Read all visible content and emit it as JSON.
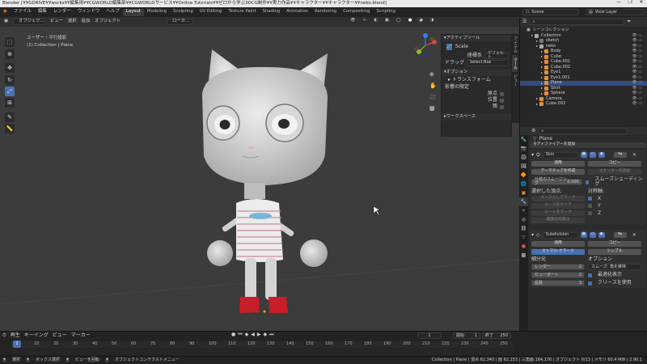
{
  "title_bar": {
    "text": "Blender [¥¥GDRIVE¥¥works¥¥編集用¥¥CGWORLD編集部¥¥CGWORLDサービス¥¥Online Tutorials¥¥ゼロから学ぶ3DCG制作¥¥実力作品¥¥キャラクター¥¥キャラクター¥¥neko.blend]",
    "controls": [
      "—",
      "❐",
      "✕"
    ]
  },
  "top_bar": {
    "menus": [
      "ファイル",
      "編集",
      "レンダー",
      "ウィンドウ",
      "ヘルプ"
    ],
    "workspaces": [
      "Layout",
      "Modeling",
      "Sculpting",
      "UV Editing",
      "Texture Paint",
      "Shading",
      "Animation",
      "Rendering",
      "Compositing",
      "Scripting"
    ],
    "active_workspace": "Layout",
    "scene_label": "Scene",
    "view_layer_label": "View Layer"
  },
  "viewport_header": {
    "mode": "オブジェク...",
    "items": [
      "ビュー",
      "選択",
      "追加",
      "オブジェクト"
    ],
    "orientation": "デフォルト",
    "drag": "ドラッ...",
    "select_mode": "Select Box",
    "pivot": "ローカ..."
  },
  "viewport": {
    "view_name": "ユーザー・平行投影",
    "collection_info": "(1) Collection | Plane"
  },
  "sidebar_tabs": [
    "アイテム",
    "ツール",
    "ビュー"
  ],
  "tool_panel": {
    "active_tool_header": "アクティブツール",
    "tool_name": "Scale",
    "orientation_label": "座標系",
    "orientation_value": "デフォルト",
    "drag_label": "ドラッグ",
    "drag_value": "Select Box",
    "options_header": "オプション",
    "transform_header": "トランスフォーム",
    "affect_only_label": "影響の限定",
    "affect_items": [
      "原点",
      "位置",
      "親"
    ],
    "workspace_header": "ワークスペース"
  },
  "outliner": {
    "header": "シーンコレクション",
    "items": [
      {
        "name": "Collection",
        "indent": 1,
        "color": "#aaaaaa"
      },
      {
        "name": "sketch",
        "indent": 2,
        "color": "#777777"
      },
      {
        "name": "neko",
        "indent": 2,
        "color": "#aaaaaa"
      },
      {
        "name": "Body",
        "indent": 3,
        "color": "#e0903a"
      },
      {
        "name": "Cube",
        "indent": 3,
        "color": "#e0903a"
      },
      {
        "name": "Cube.001",
        "indent": 3,
        "color": "#e0903a"
      },
      {
        "name": "Cube.002",
        "indent": 3,
        "color": "#e0903a"
      },
      {
        "name": "Eye1",
        "indent": 3,
        "color": "#e0903a"
      },
      {
        "name": "Eye1.001",
        "indent": 3,
        "color": "#e0903a"
      },
      {
        "name": "Plane",
        "indent": 3,
        "color": "#e0903a"
      },
      {
        "name": "Shirt",
        "indent": 3,
        "color": "#e0903a"
      },
      {
        "name": "Sphere",
        "indent": 3,
        "color": "#e0903a"
      },
      {
        "name": "Camera",
        "indent": 2,
        "color": "#e0903a"
      },
      {
        "name": "Cube.003",
        "indent": 2,
        "color": "#e0903a"
      }
    ]
  },
  "properties": {
    "object_name": "Plane",
    "add_modifier": "モディファイアーを追加",
    "skin": {
      "name": "Skin",
      "apply": "適用",
      "copy": "コピー",
      "create_armature": "アーマチュアを作成",
      "create_armature_shape": "エキンダーを追加",
      "branch_smoothing_label": "分岐のスムージング",
      "branch_smoothing_value": "0.000",
      "smooth_shading": "スムーズシェーディング",
      "selected_vertices_label": "選択した頂点:",
      "symmetry_label": "対称軸:",
      "mark_loose": "ルースとしてマーク",
      "clear_loose": "ルースをクリア",
      "mark_root": "ルートをマーク",
      "equalize_radii": "範囲の均等化",
      "axes": [
        "X",
        "Y",
        "Z"
      ]
    },
    "subdivision": {
      "name": "Subdivision",
      "apply": "適用",
      "copy": "コピー",
      "catmull_clark": "カトマル-クラーク",
      "simple": "シンプル",
      "levels_label": "細分化",
      "options_label": "オプション",
      "render_label": "レンダー",
      "render_value": "2",
      "viewport_label": "ビューポート",
      "viewport_value": "2",
      "quality_label": "品質",
      "quality_value": "3",
      "smooth_label": "スムーズ: 角を維持",
      "optimal_display": "最適化表示",
      "use_creases": "クリースを使用"
    }
  },
  "timeline": {
    "menus": [
      "再生",
      "キーイング",
      "ビュー",
      "マーカー"
    ],
    "current_frame": "1",
    "start_label": "開始",
    "start_value": "1",
    "end_label": "終了",
    "end_value": "250",
    "ticks": [
      "10",
      "20",
      "30",
      "40",
      "50",
      "60",
      "70",
      "80",
      "90",
      "100",
      "110",
      "120",
      "130",
      "140",
      "150",
      "160",
      "170",
      "180",
      "190",
      "200",
      "210",
      "220",
      "230",
      "240",
      "250"
    ]
  },
  "status_bar": {
    "select": "選択",
    "box_select": "ボックス選択",
    "rotate_view": "ビューを回転",
    "context_menu": "オブジェクトコンテクストメニュー",
    "stats": "Collection | Plane | 頂点 62,340 | 面 62,153 | 三角面 164,176 | オブジェクト 0/13 | メモリ 60.4 MiB | 2.90.1"
  },
  "colors": {
    "accent": "#4772b3",
    "viewport_bg": "#3c3c3c",
    "shoe_red": "#c81e28"
  }
}
